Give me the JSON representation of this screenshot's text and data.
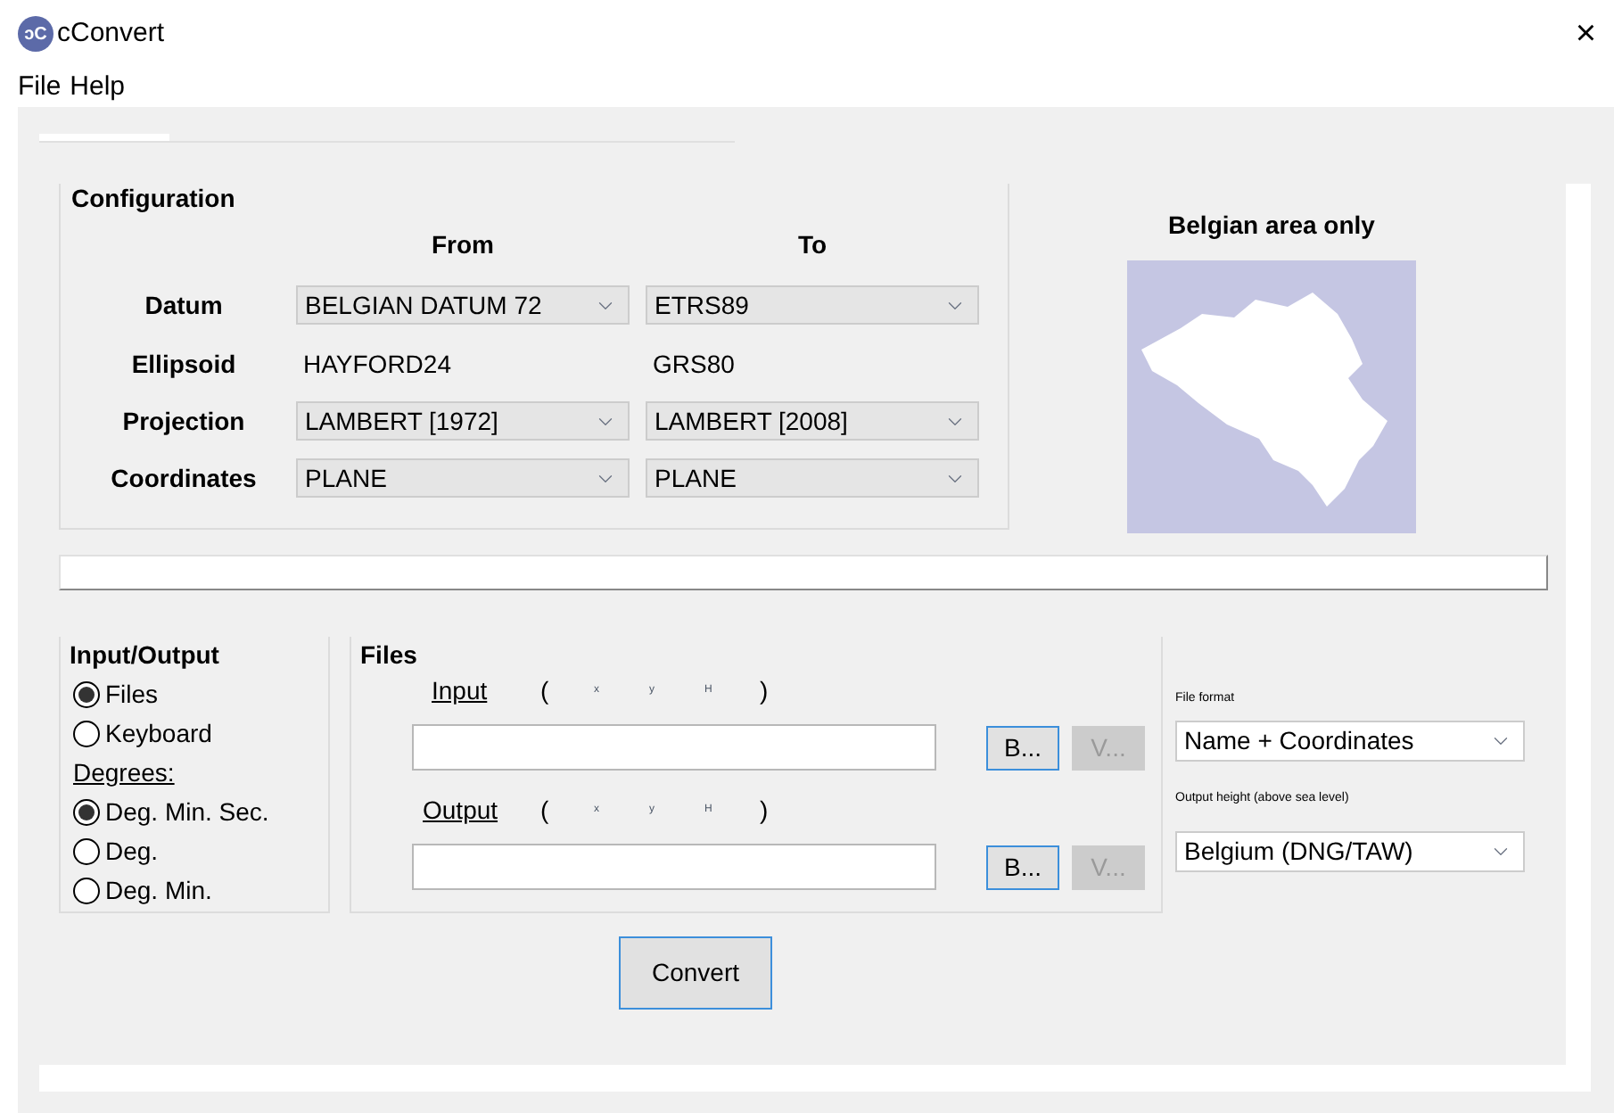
{
  "window": {
    "logo": "ɔC",
    "title": "cConvert",
    "close": "×"
  },
  "menu": [
    "File",
    "Help"
  ],
  "configuration": {
    "title": "Configuration",
    "from_header": "From",
    "to_header": "To",
    "rows": [
      {
        "label": "Datum",
        "kind": "combo",
        "from": "BELGIAN DATUM 72",
        "to": "ETRS89"
      },
      {
        "label": "Ellipsoid",
        "kind": "text",
        "from": "HAYFORD24",
        "to": "GRS80"
      },
      {
        "label": "Projection",
        "kind": "combo",
        "from": "LAMBERT [1972]",
        "to": "LAMBERT [2008]"
      },
      {
        "label": "Coordinates",
        "kind": "combo",
        "from": "PLANE",
        "to": "PLANE"
      }
    ]
  },
  "map": {
    "title": "Belgian area only"
  },
  "progress": {
    "level": 0
  },
  "input_output": {
    "title": "Input/Output",
    "sources": [
      {
        "label": "Files",
        "selected": true
      },
      {
        "label": "Keyboard",
        "selected": false
      }
    ],
    "degrees_label": "Degrees:",
    "degrees": [
      {
        "label": "Deg. Min. Sec.",
        "selected": true
      },
      {
        "label": "Deg.",
        "selected": false
      },
      {
        "label": "Deg. Min.",
        "selected": false
      }
    ]
  },
  "files": {
    "title": "Files",
    "rows": [
      {
        "label": "Input",
        "open": "(",
        "axes": [
          "x",
          "y",
          "H"
        ],
        "close": ")",
        "browse": "B...",
        "view": "V...",
        "view_disabled": true
      },
      {
        "label": "Output",
        "open": "(",
        "axes": [
          "x",
          "y",
          "H"
        ],
        "close": ")",
        "browse": "B...",
        "view": "V...",
        "view_disabled": true
      }
    ]
  },
  "file_format": {
    "label": "File format",
    "value": "Name + Coordinates"
  },
  "output_height": {
    "label": "Output height (above sea level)",
    "value": "Belgium (DNG/TAW)"
  },
  "convert": "Convert"
}
